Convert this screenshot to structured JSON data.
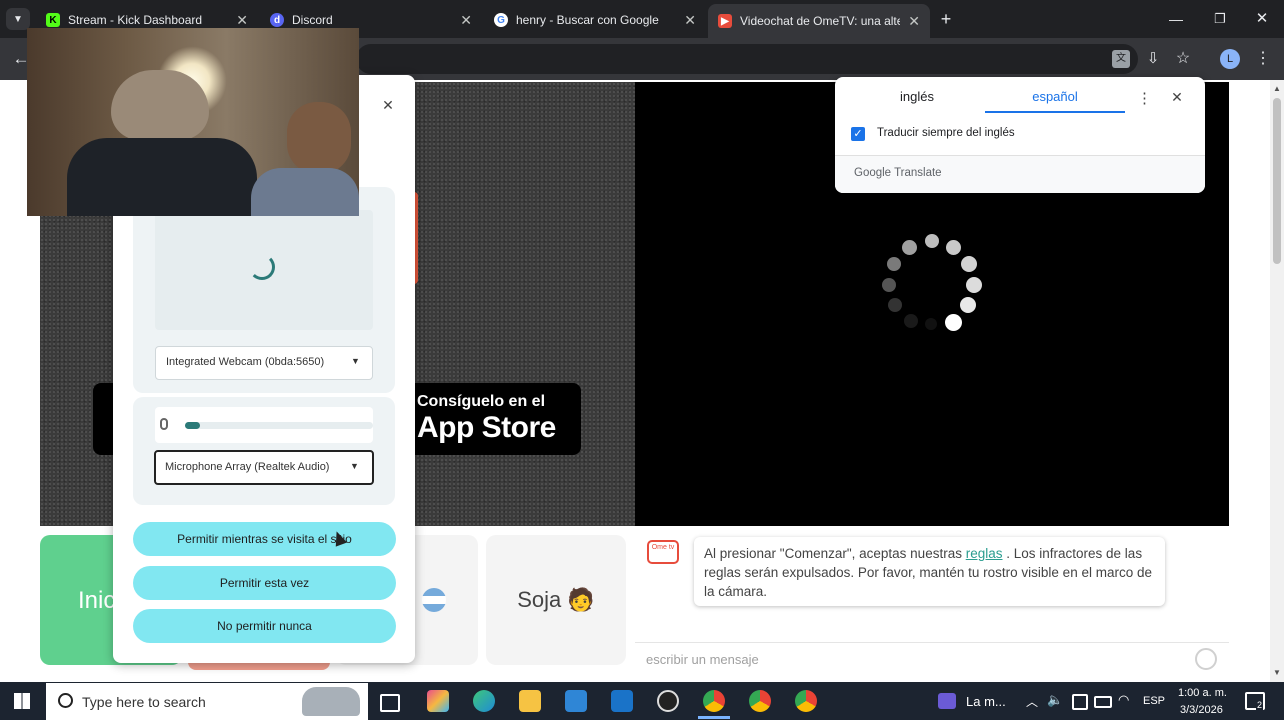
{
  "tabs": [
    {
      "label": "Stream - Kick Dashboard",
      "icon": "kick-icon",
      "color": "#53fc18"
    },
    {
      "label": "Discord",
      "icon": "discord-icon",
      "color": "#5865f2"
    },
    {
      "label": "henry - Buscar con Google",
      "icon": "google-icon",
      "color": "#4285f4"
    },
    {
      "label": "Videochat de OmeTV: una alter",
      "icon": "ometv-icon",
      "color": "#e74c3c"
    }
  ],
  "translate": {
    "tab_from": "inglés",
    "tab_to": "español",
    "checkbox_label": "Traducir siempre del inglés",
    "brand": "Google Translate"
  },
  "permission": {
    "camera_select": "Integrated Webcam (0bda:5650)",
    "mic_select": "Microphone Array (Realtek Audio)",
    "mic_level": 0.08,
    "buttons": {
      "allow_while_visiting": "Permitir mientras se visita el sitio",
      "allow_once": "Permitir esta vez",
      "never_allow": "No permitir nunca"
    }
  },
  "appstore": {
    "line1": "Consíguelo en el",
    "line2": "App Store"
  },
  "controls": {
    "start_label": "Inic",
    "gender_label": "Soja 🧑"
  },
  "chat": {
    "msg_before_link": "Al presionar \"Comenzar\", aceptas nuestras ",
    "link_text": "reglas",
    "msg_after_link": " . Los infractores de las reglas serán expulsados. Por favor, mantén tu rostro visible en el marco de la cámara.",
    "logo_text": "Ome tv",
    "input_placeholder": "escribir un mensaje"
  },
  "taskbar": {
    "search_placeholder": "Type here to search",
    "app_label": "La m...",
    "lang": "ESP",
    "time": "1:00 a. m.",
    "date": "3/3/2026",
    "notifications": "2"
  },
  "colors": {
    "accent": "#2b7a78",
    "allow_button": "#81e7f1",
    "start_green": "#5fd08e"
  }
}
